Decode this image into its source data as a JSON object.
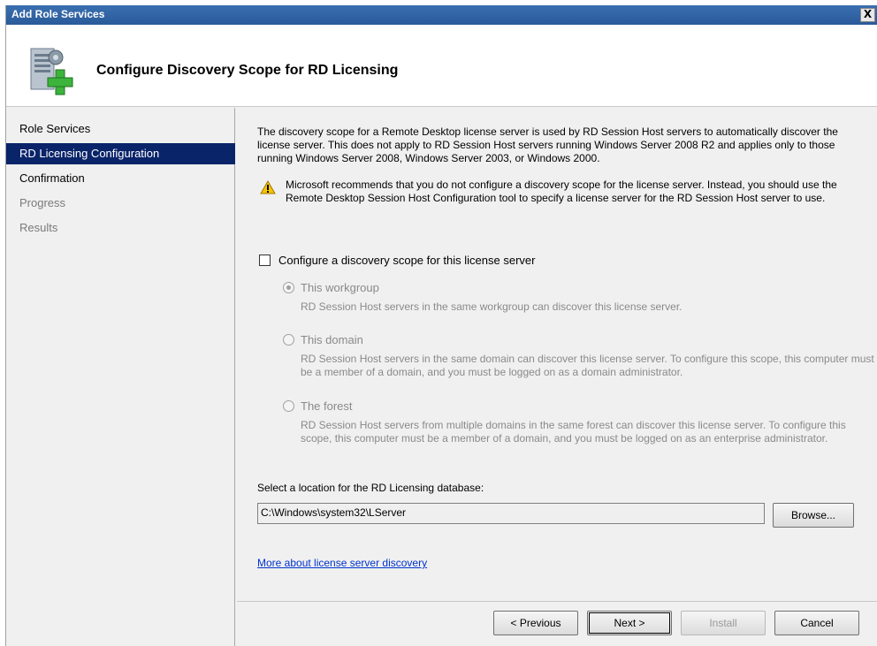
{
  "window": {
    "title": "Add Role Services",
    "close_label": "X"
  },
  "header": {
    "title": "Configure Discovery Scope for RD Licensing",
    "icon": "server-add-icon"
  },
  "nav": {
    "items": [
      {
        "label": "Role Services",
        "state": "normal"
      },
      {
        "label": "RD Licensing Configuration",
        "state": "active"
      },
      {
        "label": "Confirmation",
        "state": "normal"
      },
      {
        "label": "Progress",
        "state": "disabled"
      },
      {
        "label": "Results",
        "state": "disabled"
      }
    ]
  },
  "content": {
    "intro": "The discovery scope for a Remote Desktop license server is used by RD Session Host servers to automatically discover the license server. This does not apply to RD Session Host servers running Windows Server 2008 R2 and applies only to those running Windows Server 2008, Windows Server 2003, or Windows 2000.",
    "warning": "Microsoft recommends that you do not configure a discovery scope for the license server. Instead, you should use the Remote Desktop Session Host Configuration tool to specify a license server for the RD Session Host server to use.",
    "checkbox_label": "Configure a discovery scope for this license server",
    "checkbox_checked": false,
    "options": [
      {
        "label": "This workgroup",
        "selected": true,
        "description": "RD Session Host servers in the same workgroup can discover this license server."
      },
      {
        "label": "This domain",
        "selected": false,
        "description": "RD Session Host servers in the same domain can discover this license server. To configure this scope, this computer must be a member of a domain, and you must be logged on as a domain administrator."
      },
      {
        "label": "The forest",
        "selected": false,
        "description": "RD Session Host servers from multiple domains in the same forest can discover this license server. To configure this scope, this computer must be a member of a domain, and you must be logged on as an enterprise administrator."
      }
    ],
    "db_label": "Select a location for the RD Licensing database:",
    "db_path": "C:\\Windows\\system32\\LServer",
    "browse_label": "Browse...",
    "link_text": "More about license server discovery"
  },
  "footer": {
    "previous": "< Previous",
    "next": "Next >",
    "install": "Install",
    "cancel": "Cancel"
  },
  "colors": {
    "title_bar": "#2a5a9a",
    "nav_active": "#0a246a",
    "link": "#0033cc",
    "disabled_text": "#8a8a8a"
  }
}
